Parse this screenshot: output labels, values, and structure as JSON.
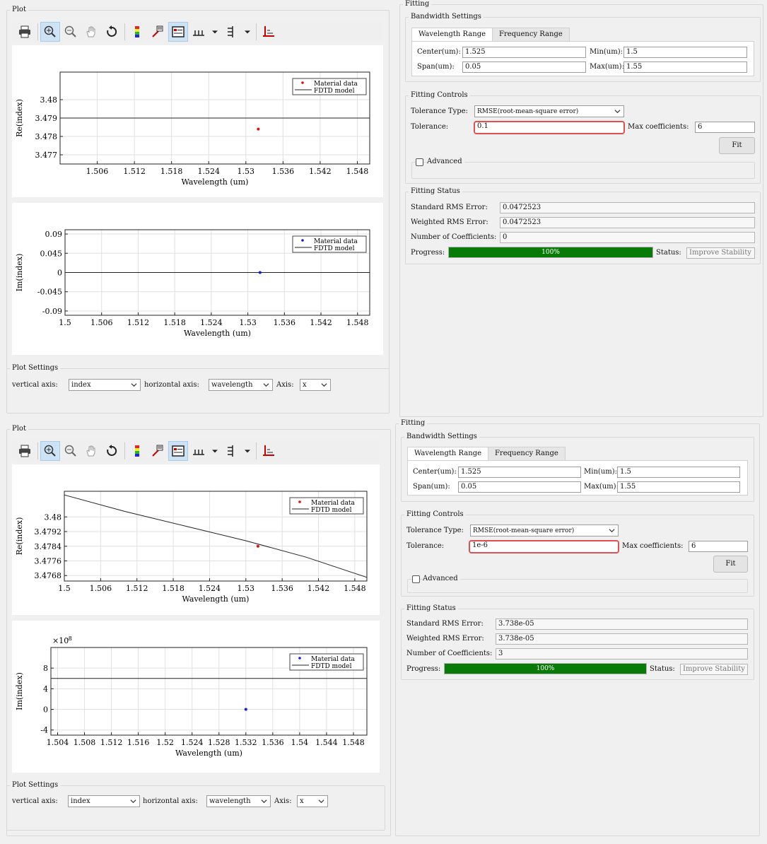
{
  "top": {
    "plot_title": "Plot",
    "charts": [
      {
        "type": "line",
        "ylabel": "Re(index)",
        "xlabel": "Wavelength (um)",
        "ylim": [
          3.4765,
          3.4815
        ],
        "xlim": [
          1.5,
          1.55
        ],
        "yticks": [
          "3.477",
          "3.478",
          "3.479",
          "3.48"
        ],
        "xticks": [
          "1.506",
          "1.512",
          "1.518",
          "1.524",
          "1.53",
          "1.536",
          "1.542",
          "1.548"
        ],
        "legend": [
          "Material data",
          "FDTD model"
        ]
      },
      {
        "type": "line",
        "ylabel": "Im(index)",
        "xlabel": "Wavelength (um)",
        "ylim": [
          -0.1,
          0.1
        ],
        "yticks": [
          "-0.09",
          "-0.045",
          "0",
          "0.045",
          "0.09"
        ],
        "xticks": [
          "1.5",
          "1.506",
          "1.512",
          "1.518",
          "1.524",
          "1.53",
          "1.536",
          "1.542",
          "1.548"
        ],
        "legend": [
          "Material data",
          "FDTD model"
        ]
      }
    ],
    "plot_settings": {
      "title": "Plot Settings",
      "vertical_label": "vertical axis:",
      "vertical_value": "index",
      "horizontal_label": "horizontal axis:",
      "horizontal_value": "wavelength",
      "axis_label": "Axis:",
      "axis_value": "x"
    },
    "fitting": {
      "title": "Fitting",
      "bandwidth_title": "Bandwidth Settings",
      "tab_wavelength": "Wavelength Range",
      "tab_frequency": "Frequency Range",
      "center_label": "Center(um):",
      "center_value": "1.525",
      "min_label": "Min(um):",
      "min_value": "1.5",
      "span_label": "Span(um):",
      "span_value": "0.05",
      "max_label": "Max(um):",
      "max_value": "1.55",
      "controls_title": "Fitting Controls",
      "tolerance_type_label": "Tolerance Type:",
      "tolerance_type_value": "RMSE(root-mean-square error)",
      "tolerance_label": "Tolerance:",
      "tolerance_value": "0.1",
      "max_coeff_label": "Max coefficients:",
      "max_coeff_value": "6",
      "fit_button": "Fit",
      "advanced_label": "Advanced",
      "status_title": "Fitting Status",
      "std_rms_label": "Standard RMS Error:",
      "std_rms_value": "0.0472523",
      "wtd_rms_label": "Weighted RMS Error:",
      "wtd_rms_value": "0.0472523",
      "num_coeff_label": "Number of Coefficients:",
      "num_coeff_value": "0",
      "progress_label": "Progress:",
      "progress_text": "100%",
      "progress_fraction": 1.0,
      "status_label": "Status:",
      "status_value": "Improve Stability"
    }
  },
  "bottom": {
    "plot_title": "Plot",
    "charts": [
      {
        "type": "line",
        "ylabel": "Re(index)",
        "xlabel": "Wavelength (um)",
        "ylim": [
          3.4765,
          3.4814
        ],
        "xlim": [
          1.5,
          1.55
        ],
        "yticks": [
          "3.4768",
          "3.4776",
          "3.4784",
          "3.4792",
          "3.48"
        ],
        "xticks": [
          "1.5",
          "1.506",
          "1.512",
          "1.518",
          "1.524",
          "1.53",
          "1.536",
          "1.542",
          "1.548"
        ],
        "legend": [
          "Material data",
          "FDTD model"
        ]
      },
      {
        "type": "line",
        "ylabel": "Im(index)",
        "xlabel": "Wavelength (um)",
        "exponent_label": "×10",
        "exponent_power": "-8",
        "ylim": [
          -4,
          12
        ],
        "yticks": [
          "-4",
          "0",
          "4",
          "8"
        ],
        "xticks": [
          "1.504",
          "1.508",
          "1.512",
          "1.516",
          "1.52",
          "1.524",
          "1.528",
          "1.532",
          "1.536",
          "1.54",
          "1.544",
          "1.548"
        ],
        "legend": [
          "Material data",
          "FDTD model"
        ]
      }
    ],
    "plot_settings": {
      "title": "Plot Settings",
      "vertical_label": "vertical axis:",
      "vertical_value": "index",
      "horizontal_label": "horizontal axis:",
      "horizontal_value": "wavelength",
      "axis_label": "Axis:",
      "axis_value": "x"
    },
    "fitting": {
      "title": "Fitting",
      "bandwidth_title": "Bandwidth Settings",
      "tab_wavelength": "Wavelength Range",
      "tab_frequency": "Frequency Range",
      "center_label": "Center(um):",
      "center_value": "1.525",
      "min_label": "Min(um):",
      "min_value": "1.5",
      "span_label": "Span(um):",
      "span_value": "0.05",
      "max_label": "Max(um):",
      "max_value": "1.55",
      "controls_title": "Fitting Controls",
      "tolerance_type_label": "Tolerance Type:",
      "tolerance_type_value": "RMSE(root-mean-square error)",
      "tolerance_label": "Tolerance:",
      "tolerance_value": "1e-6",
      "max_coeff_label": "Max coefficients:",
      "max_coeff_value": "6",
      "fit_button": "Fit",
      "advanced_label": "Advanced",
      "status_title": "Fitting Status",
      "std_rms_label": "Standard RMS Error:",
      "std_rms_value": "3.738e-05",
      "wtd_rms_label": "Weighted RMS Error:",
      "wtd_rms_value": "3.738e-05",
      "num_coeff_label": "Number of Coefficients:",
      "num_coeff_value": "3",
      "progress_label": "Progress:",
      "progress_text": "100%",
      "progress_fraction": 1.0,
      "status_label": "Status:",
      "status_value": "Improve Stability"
    }
  },
  "chart_data": [
    {
      "type": "scatter",
      "series": [
        {
          "name": "Material data",
          "x": [
            1.532
          ],
          "y": [
            3.4784
          ]
        },
        {
          "name": "FDTD model",
          "x": [
            1.5,
            1.55
          ],
          "y": [
            3.479,
            3.479
          ]
        }
      ],
      "xlabel": "Wavelength (um)",
      "ylabel": "Re(index)",
      "ylim": [
        3.4765,
        3.4815
      ],
      "legend": "top-right",
      "grid": true
    },
    {
      "type": "scatter",
      "series": [
        {
          "name": "Material data",
          "x": [
            1.532
          ],
          "y": [
            0
          ]
        },
        {
          "name": "FDTD model",
          "x": [
            1.5,
            1.55
          ],
          "y": [
            0,
            0
          ]
        }
      ],
      "xlabel": "Wavelength (um)",
      "ylabel": "Im(index)",
      "ylim": [
        -0.1,
        0.1
      ],
      "legend": "top-right",
      "grid": true
    },
    {
      "type": "scatter",
      "series": [
        {
          "name": "Material data",
          "x": [
            1.532
          ],
          "y": [
            3.4784
          ]
        },
        {
          "name": "FDTD model",
          "x": [
            1.5,
            1.51,
            1.52,
            1.53,
            1.54,
            1.55
          ],
          "y": [
            3.4812,
            3.4803,
            3.4795,
            3.4787,
            3.4778,
            3.4767
          ]
        }
      ],
      "xlabel": "Wavelength (um)",
      "ylabel": "Re(index)",
      "ylim": [
        3.4765,
        3.4814
      ],
      "legend": "top-right",
      "grid": true
    },
    {
      "type": "scatter",
      "series": [
        {
          "name": "Material data",
          "x": [
            1.532
          ],
          "y": [
            0
          ]
        },
        {
          "name": "FDTD model",
          "x": [
            1.503,
            1.55
          ],
          "y": [
            6.0,
            6.0
          ]
        }
      ],
      "xlabel": "Wavelength (um)",
      "ylabel": "Im(index)",
      "ylim": [
        -4,
        12
      ],
      "legend": "top-right",
      "grid": true
    }
  ],
  "icons": [
    "print-icon",
    "zoom-in-icon",
    "zoom-out-icon",
    "pan-hand-icon",
    "reset-icon",
    "colormap-icon",
    "data-cursor-icon",
    "legend-icon",
    "markers-icon",
    "dropdown-icon",
    "align-icon",
    "axes-icon"
  ]
}
